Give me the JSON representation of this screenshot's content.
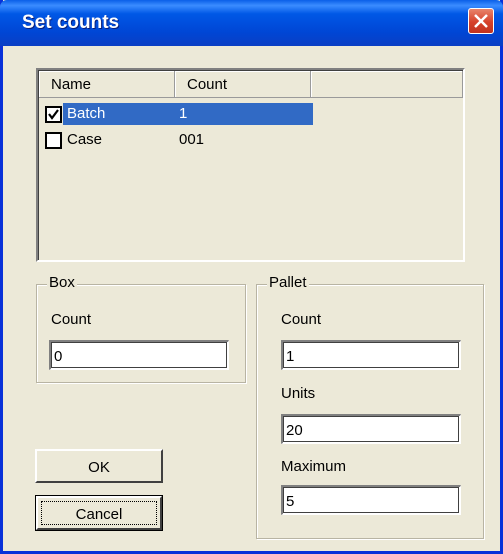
{
  "window": {
    "title": "Set counts"
  },
  "list": {
    "columns": [
      "Name",
      "Count"
    ],
    "rows": [
      {
        "name": "Batch",
        "count": "1",
        "checked": true,
        "selected": true
      },
      {
        "name": "Case",
        "count": "001",
        "checked": false,
        "selected": false
      }
    ]
  },
  "box": {
    "title": "Box",
    "count_label": "Count",
    "count_value": "0"
  },
  "pallet": {
    "title": "Pallet",
    "count_label": "Count",
    "count_value": "1",
    "units_label": "Units",
    "units_value": "20",
    "maximum_label": "Maximum",
    "maximum_value": "5"
  },
  "buttons": {
    "ok": "OK",
    "cancel": "Cancel"
  },
  "colors": {
    "title_bar": "#0054e3",
    "selection": "#316ac5",
    "dialog_bg": "#ece9d8",
    "close_button": "#d6412a"
  }
}
